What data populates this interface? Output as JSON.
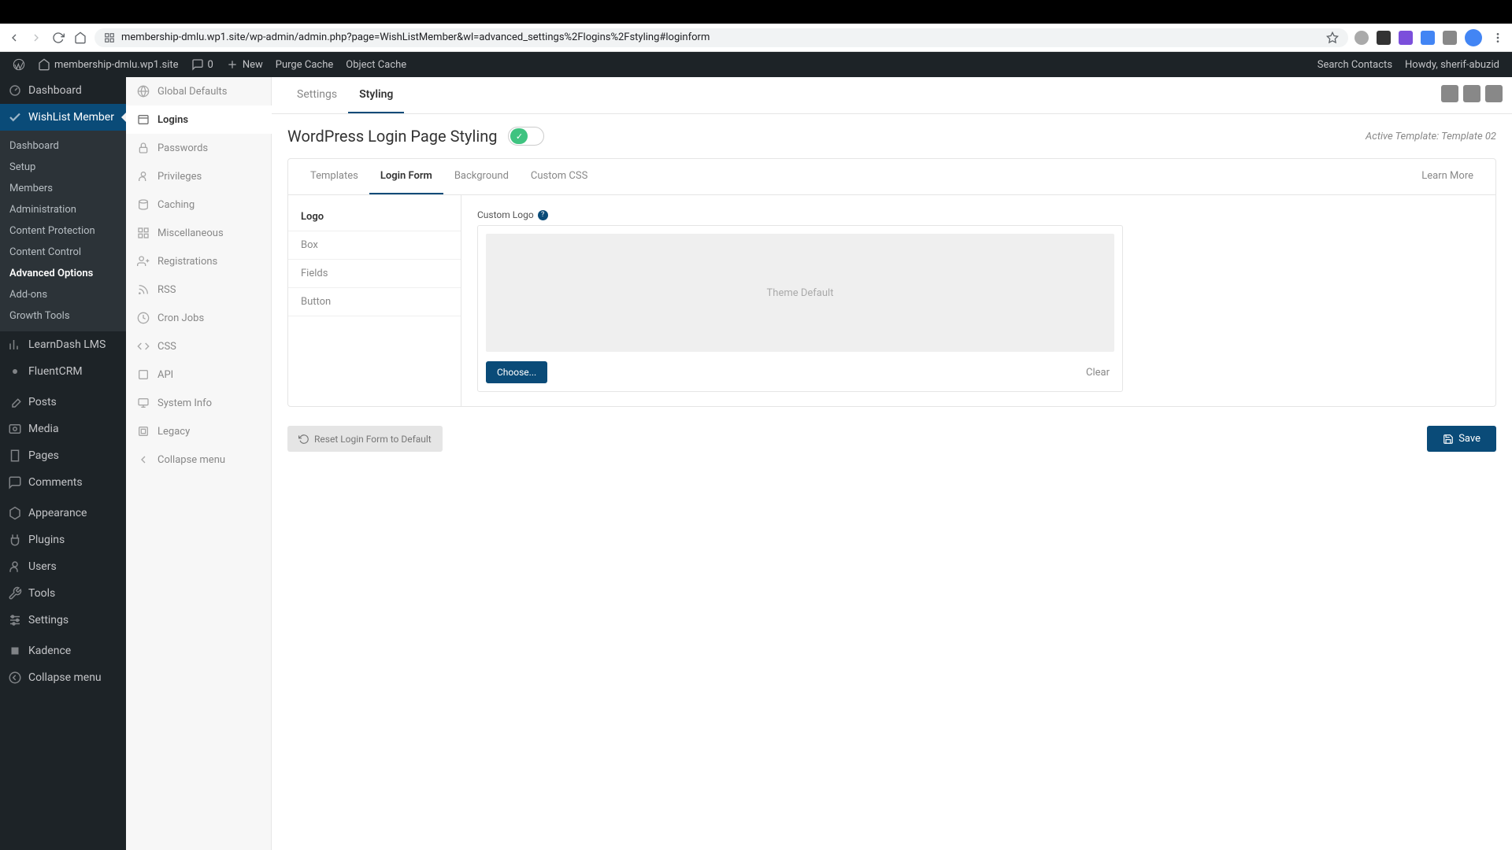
{
  "browser": {
    "url": "membership-dmlu.wp1.site/wp-admin/admin.php?page=WishListMember&wl=advanced_settings%2Flogins%2Fstyling#loginform"
  },
  "wpbar": {
    "site": "membership-dmlu.wp1.site",
    "comments": "0",
    "new": "New",
    "purge": "Purge Cache",
    "object": "Object Cache",
    "search": "Search Contacts",
    "howdy": "Howdy, sherif-abuzid"
  },
  "wpmenu": {
    "dashboard": "Dashboard",
    "wishlist": "WishList Member",
    "sub": {
      "dashboard": "Dashboard",
      "setup": "Setup",
      "members": "Members",
      "admin": "Administration",
      "protection": "Content Protection",
      "control": "Content Control",
      "advanced": "Advanced Options",
      "addons": "Add-ons",
      "growth": "Growth Tools"
    },
    "learndash": "LearnDash LMS",
    "fluentcrm": "FluentCRM",
    "posts": "Posts",
    "media": "Media",
    "pages": "Pages",
    "comments": "Comments",
    "appearance": "Appearance",
    "plugins": "Plugins",
    "users": "Users",
    "tools": "Tools",
    "settings": "Settings",
    "kadence": "Kadence",
    "collapse": "Collapse menu"
  },
  "secmenu": {
    "global": "Global Defaults",
    "logins": "Logins",
    "passwords": "Passwords",
    "privileges": "Privileges",
    "caching": "Caching",
    "misc": "Miscellaneous",
    "reg": "Registrations",
    "rss": "RSS",
    "cron": "Cron Jobs",
    "css": "CSS",
    "api": "API",
    "sysinfo": "System Info",
    "legacy": "Legacy",
    "collapse": "Collapse menu"
  },
  "toptabs": {
    "settings": "Settings",
    "styling": "Styling"
  },
  "page": {
    "title": "WordPress Login Page Styling",
    "active_template": "Active Template: Template 02"
  },
  "innertabs": {
    "templates": "Templates",
    "loginform": "Login Form",
    "background": "Background",
    "customcss": "Custom CSS",
    "learnmore": "Learn More"
  },
  "sidetabs": {
    "logo": "Logo",
    "box": "Box",
    "fields": "Fields",
    "button": "Button"
  },
  "form": {
    "custom_logo_label": "Custom Logo",
    "theme_default": "Theme Default",
    "choose": "Choose...",
    "clear": "Clear"
  },
  "footer": {
    "reset": "Reset Login Form to Default",
    "save": "Save"
  }
}
